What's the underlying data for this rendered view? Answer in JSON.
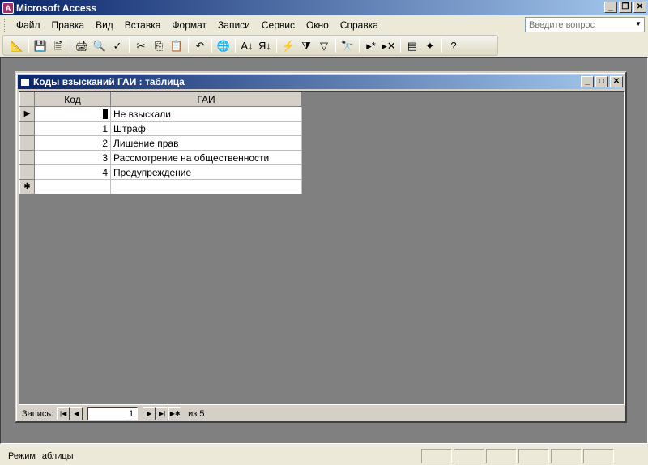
{
  "window": {
    "title": "Microsoft Access",
    "controls": [
      "_",
      "❐",
      "✕"
    ]
  },
  "menu": [
    "Файл",
    "Правка",
    "Вид",
    "Вставка",
    "Формат",
    "Записи",
    "Сервис",
    "Окно",
    "Справка"
  ],
  "ask_question": {
    "placeholder": "Введите вопрос"
  },
  "toolbar": {
    "icons": [
      {
        "name": "view-design-icon",
        "glyph": "📐"
      },
      {
        "name": "save-icon",
        "glyph": "💾"
      },
      {
        "name": "search-file-icon",
        "glyph": "🗎"
      },
      {
        "name": "print-icon",
        "glyph": "🖨"
      },
      {
        "name": "print-preview-icon",
        "glyph": "🔍"
      },
      {
        "name": "spelling-icon",
        "glyph": "✓"
      },
      {
        "name": "cut-icon",
        "glyph": "✂"
      },
      {
        "name": "copy-icon",
        "glyph": "⎘"
      },
      {
        "name": "paste-icon",
        "glyph": "📋"
      },
      {
        "name": "undo-icon",
        "glyph": "↶"
      },
      {
        "name": "hyperlink-icon",
        "glyph": "🌐"
      },
      {
        "name": "sort-ascending-icon",
        "glyph": "A↓"
      },
      {
        "name": "sort-descending-icon",
        "glyph": "Я↓"
      },
      {
        "name": "filter-by-selection-icon",
        "glyph": "⚡"
      },
      {
        "name": "filter-by-form-icon",
        "glyph": "⧩"
      },
      {
        "name": "apply-filter-icon",
        "glyph": "▽"
      },
      {
        "name": "find-icon",
        "glyph": "🔭"
      },
      {
        "name": "new-record-icon",
        "glyph": "▸*"
      },
      {
        "name": "delete-record-icon",
        "glyph": "▸✕"
      },
      {
        "name": "database-window-icon",
        "glyph": "▤"
      },
      {
        "name": "new-object-icon",
        "glyph": "✦"
      },
      {
        "name": "help-icon",
        "glyph": "?"
      }
    ]
  },
  "table_window": {
    "title": "Коды взысканий ГАИ : таблица",
    "columns": [
      "Код",
      "ГАИ"
    ],
    "rows": [
      {
        "code": "0",
        "name": "Не взыскали"
      },
      {
        "code": "1",
        "name": "Штраф"
      },
      {
        "code": "2",
        "name": "Лишение прав"
      },
      {
        "code": "3",
        "name": "Рассмотрение на общественности"
      },
      {
        "code": "4",
        "name": "Предупреждение"
      }
    ],
    "new_row_marker": "✱",
    "current_row_marker": "▶"
  },
  "navigation": {
    "label": "Запись:",
    "current": "1",
    "of_total": "из 5",
    "buttons": [
      "|◀",
      "◀",
      "▶",
      "▶|",
      "▶✱"
    ]
  },
  "status": {
    "text": "Режим таблицы"
  }
}
